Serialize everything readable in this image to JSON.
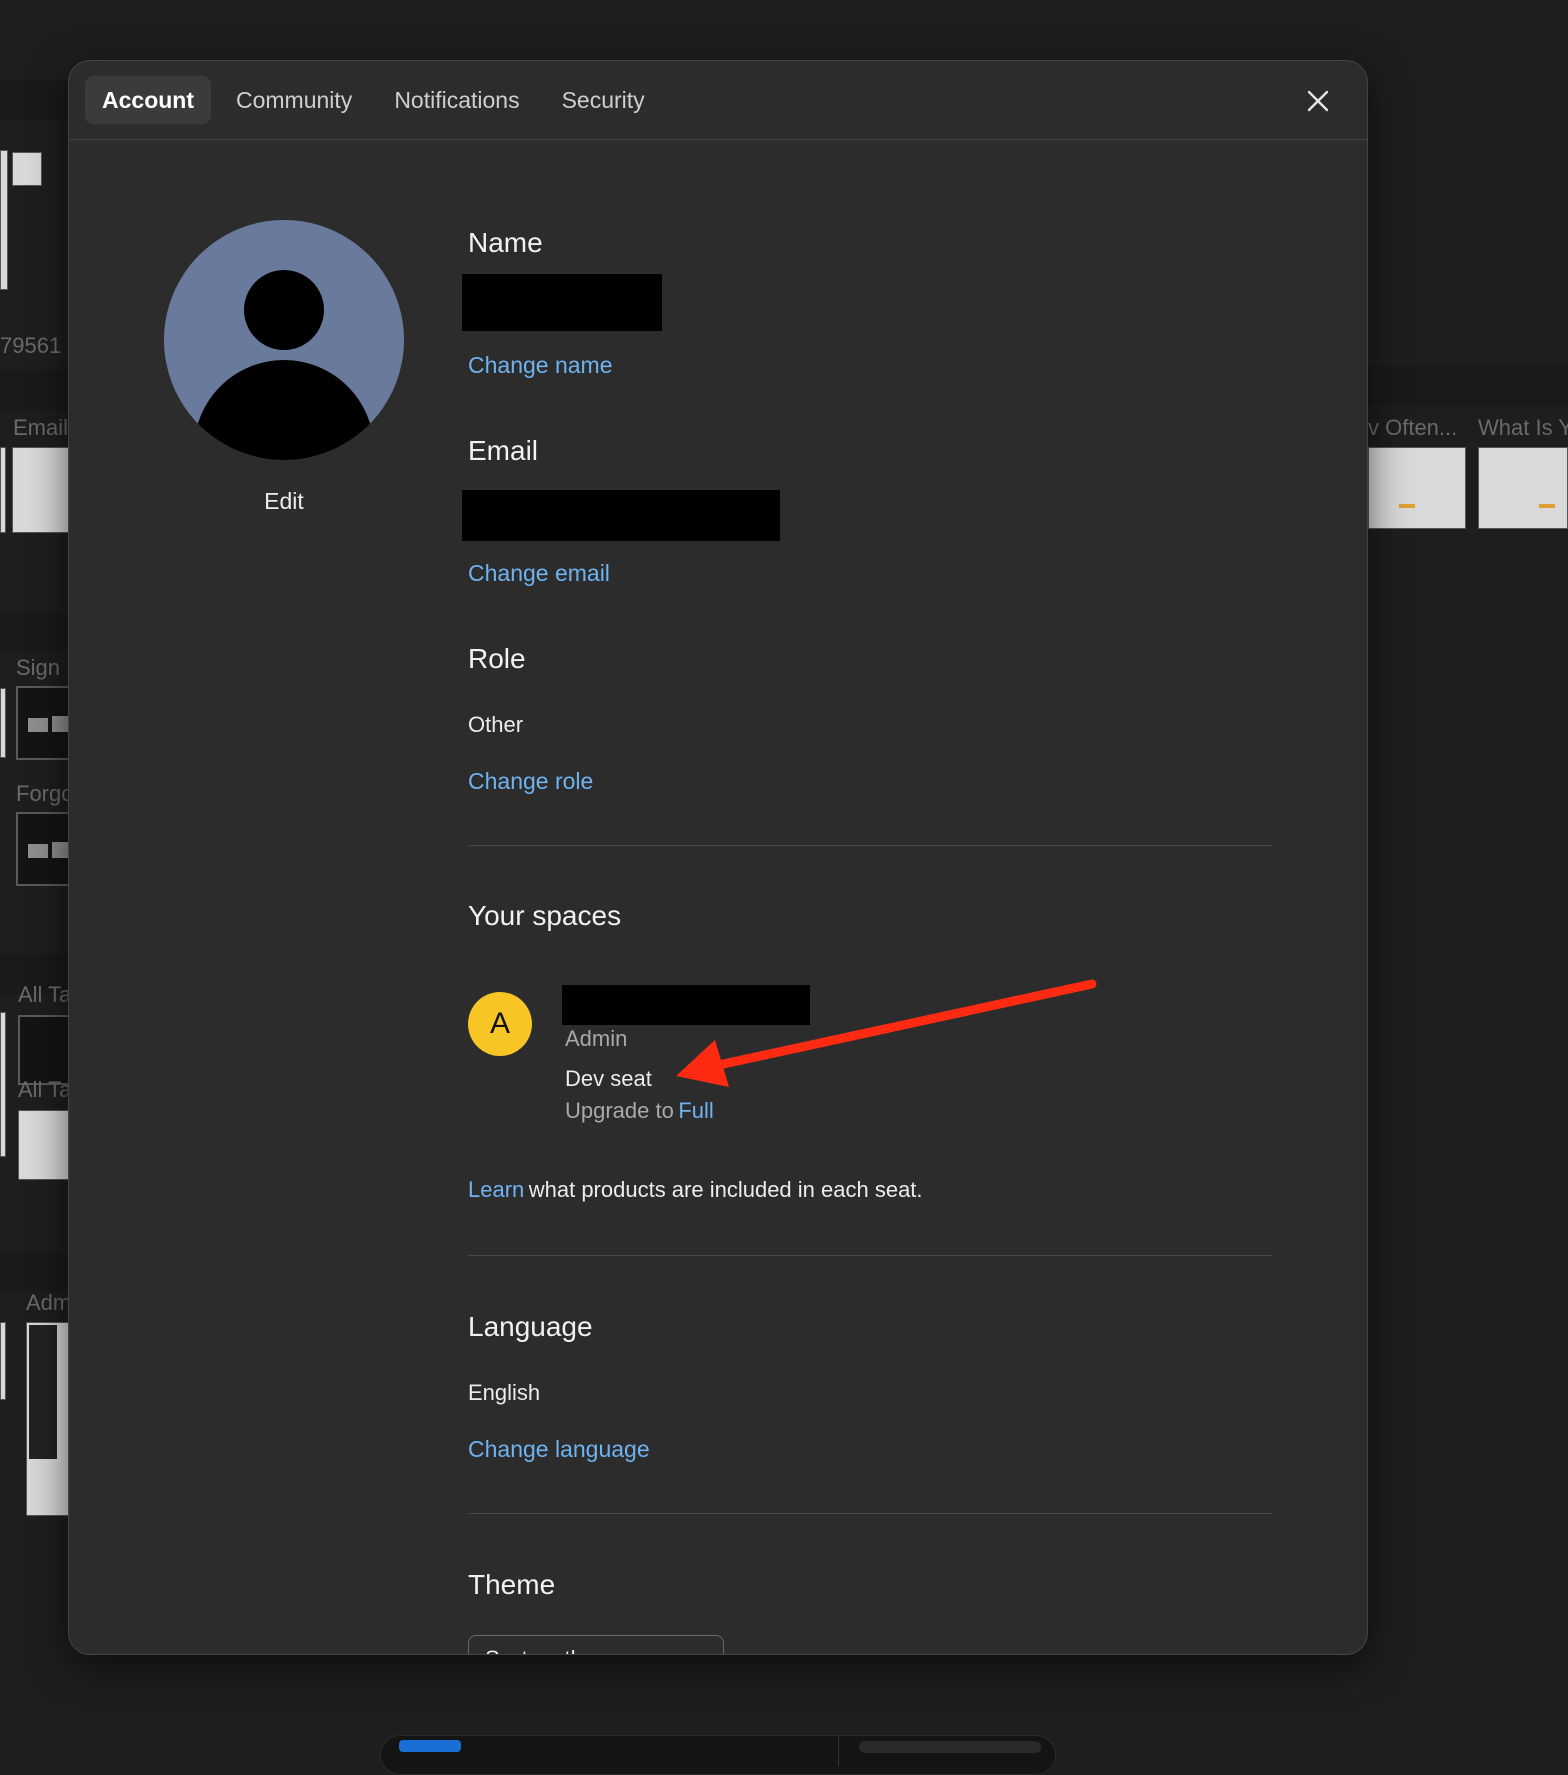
{
  "background": {
    "labels": {
      "number": "79561",
      "email": "Email",
      "sign": "Sign",
      "forgot": "Forgo",
      "all_1": "All Ta",
      "all_2": "All Ta",
      "admin": "Adm",
      "right_1": "v Often...",
      "right_2": "What Is Y"
    }
  },
  "tabs": [
    {
      "label": "Account",
      "active": true
    },
    {
      "label": "Community",
      "active": false
    },
    {
      "label": "Notifications",
      "active": false
    },
    {
      "label": "Security",
      "active": false
    }
  ],
  "close_icon": "close-icon",
  "avatar": {
    "edit_label": "Edit",
    "color": "#6a7a9c"
  },
  "name": {
    "heading": "Name",
    "change_label": "Change name"
  },
  "email": {
    "heading": "Email",
    "change_label": "Change email"
  },
  "role": {
    "heading": "Role",
    "value": "Other",
    "change_label": "Change role"
  },
  "spaces": {
    "heading": "Your spaces",
    "item": {
      "initial": "A",
      "role": "Admin",
      "seat": "Dev seat",
      "upgrade_prefix": "Upgrade to",
      "upgrade_link": "Full",
      "avatar_color": "#f7c624"
    },
    "learn_link": "Learn",
    "learn_text": "what products are included in each seat."
  },
  "language": {
    "heading": "Language",
    "value": "English",
    "change_label": "Change language"
  },
  "theme": {
    "heading": "Theme",
    "selected": "System theme"
  },
  "colors": {
    "link": "#6fb3f0",
    "annotation_arrow": "#ff2a12",
    "modal_bg": "#2c2c2c"
  }
}
